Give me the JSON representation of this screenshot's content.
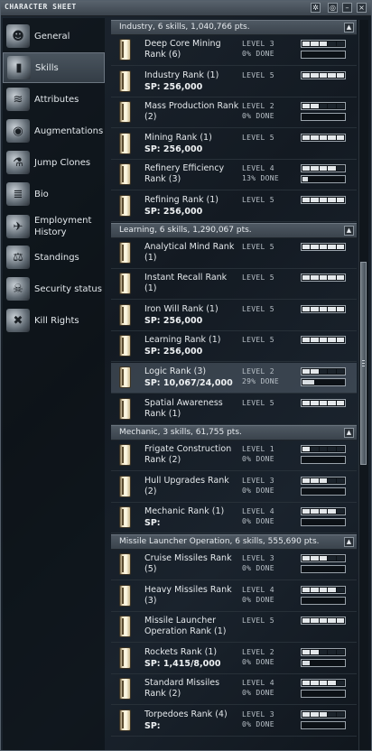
{
  "window": {
    "title": "CHARACTER SHEET"
  },
  "sidebar": {
    "items": [
      {
        "label": "General",
        "icon": "portrait-icon",
        "active": false
      },
      {
        "label": "Skills",
        "icon": "skillbook-icon",
        "active": true
      },
      {
        "label": "Attributes",
        "icon": "dna-icon",
        "active": false
      },
      {
        "label": "Augmentations",
        "icon": "implant-head-icon",
        "active": false
      },
      {
        "label": "Jump Clones",
        "icon": "clone-icon",
        "active": false
      },
      {
        "label": "Bio",
        "icon": "document-icon",
        "active": false
      },
      {
        "label": "Employment History",
        "icon": "corporation-icon",
        "active": false
      },
      {
        "label": "Standings",
        "icon": "standings-icon",
        "active": false
      },
      {
        "label": "Security status",
        "icon": "skull-icon",
        "active": false
      },
      {
        "label": "Kill Rights",
        "icon": "kill-rights-icon",
        "active": false
      }
    ]
  },
  "groups": [
    {
      "label": "Industry, 6 skills, 1,040,766 pts.",
      "skills": [
        {
          "name": "Deep Core Mining Rank (6)",
          "sp": "",
          "level": "LEVEL 3",
          "done": "0% DONE",
          "trained": 3,
          "progress": 0
        },
        {
          "name": "Industry Rank (1)",
          "sp": "SP: 256,000",
          "level": "LEVEL 5",
          "done": "",
          "trained": 5,
          "progress": null
        },
        {
          "name": "Mass Production Rank (2)",
          "sp": "",
          "level": "LEVEL 2",
          "done": "0% DONE",
          "trained": 2,
          "progress": 0
        },
        {
          "name": "Mining Rank (1)",
          "sp": "SP: 256,000",
          "level": "LEVEL 5",
          "done": "",
          "trained": 5,
          "progress": null
        },
        {
          "name": "Refinery Efficiency Rank (3)",
          "sp": "",
          "level": "LEVEL 4",
          "done": "13% DONE",
          "trained": 4,
          "progress": 0.13
        },
        {
          "name": "Refining Rank (1)",
          "sp": "SP: 256,000",
          "level": "LEVEL 5",
          "done": "",
          "trained": 5,
          "progress": null
        }
      ]
    },
    {
      "label": "Learning, 6 skills, 1,290,067 pts.",
      "skills": [
        {
          "name": "Analytical Mind Rank (1)",
          "sp": "",
          "level": "LEVEL 5",
          "done": "",
          "trained": 5,
          "progress": null
        },
        {
          "name": "Instant Recall Rank (1)",
          "sp": "",
          "level": "LEVEL 5",
          "done": "",
          "trained": 5,
          "progress": null
        },
        {
          "name": "Iron Will Rank (1)",
          "sp": "SP: 256,000",
          "level": "LEVEL 5",
          "done": "",
          "trained": 5,
          "progress": null
        },
        {
          "name": "Learning Rank (1)",
          "sp": "SP: 256,000",
          "level": "LEVEL 5",
          "done": "",
          "trained": 5,
          "progress": null
        },
        {
          "name": "Logic Rank (3)",
          "sp": "SP: 10,067/24,000",
          "level": "LEVEL 2",
          "done": "29% DONE",
          "trained": 2,
          "progress": 0.29,
          "highlight": true
        },
        {
          "name": "Spatial Awareness Rank (1)",
          "sp": "",
          "level": "LEVEL 5",
          "done": "",
          "trained": 5,
          "progress": null
        }
      ]
    },
    {
      "label": "Mechanic, 3 skills, 61,755 pts.",
      "skills": [
        {
          "name": "Frigate Construction Rank (2)",
          "sp": "",
          "level": "LEVEL 1",
          "done": "0% DONE",
          "trained": 1,
          "progress": 0
        },
        {
          "name": "Hull Upgrades Rank (2)",
          "sp": "",
          "level": "LEVEL 3",
          "done": "0% DONE",
          "trained": 3,
          "progress": 0
        },
        {
          "name": "Mechanic Rank (1)",
          "sp": "SP:",
          "level": "LEVEL 4",
          "done": "0% DONE",
          "trained": 4,
          "progress": 0
        }
      ]
    },
    {
      "label": "Missile Launcher Operation, 6 skills, 555,690 pts.",
      "skills": [
        {
          "name": "Cruise Missiles Rank (5)",
          "sp": "",
          "level": "LEVEL 3",
          "done": "0% DONE",
          "trained": 3,
          "progress": 0
        },
        {
          "name": "Heavy Missiles Rank (3)",
          "sp": "",
          "level": "LEVEL 4",
          "done": "0% DONE",
          "trained": 4,
          "progress": 0
        },
        {
          "name": "Missile Launcher Operation Rank (1)",
          "sp": "",
          "level": "LEVEL 5",
          "done": "",
          "trained": 5,
          "progress": null
        },
        {
          "name": "Rockets Rank (1)",
          "sp": "SP: 1,415/8,000",
          "level": "LEVEL 2",
          "done": "0% DONE",
          "trained": 2,
          "progress": 0.18
        },
        {
          "name": "Standard Missiles Rank (2)",
          "sp": "",
          "level": "LEVEL 4",
          "done": "0% DONE",
          "trained": 4,
          "progress": 0
        },
        {
          "name": "Torpedoes Rank (4)",
          "sp": "SP:",
          "level": "LEVEL 3",
          "done": "0% DONE",
          "trained": 3,
          "progress": 0
        }
      ]
    }
  ]
}
